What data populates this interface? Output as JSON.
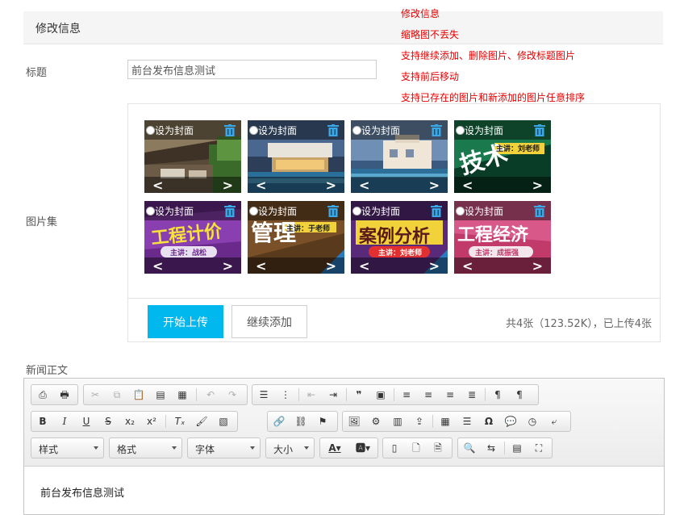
{
  "header": {
    "title": "修改信息"
  },
  "notes": [
    "修改信息",
    "缩略图不丢失",
    "支持继续添加、删除图片、修改标题图片",
    "支持前后移动",
    "支持已存在的图片和新添加的图片任意排序"
  ],
  "form": {
    "title_label": "标题",
    "title_value": "前台发布信息测试",
    "gallery_label": "图片集",
    "body_label": "新闻正文"
  },
  "gallery": {
    "cover_label": "设为封面",
    "prev_glyph": "<",
    "next_glyph": ">",
    "images": [
      {
        "overlay": ""
      },
      {
        "overlay": ""
      },
      {
        "overlay": ""
      },
      {
        "overlay": "技术",
        "sub": "主讲：刘老师"
      },
      {
        "overlay": "工程计价",
        "sub": "主讲：战松"
      },
      {
        "overlay": "管理",
        "sub": "主讲：于老师"
      },
      {
        "overlay": "案例分析",
        "sub": "主讲：刘老师"
      },
      {
        "overlay": "工程经济",
        "sub": "主讲：成振强"
      }
    ],
    "upload_button": "开始上传",
    "add_button": "继续添加",
    "stats": "共4张（123.52K），已上传4张"
  },
  "editor": {
    "combos": [
      "样式",
      "格式",
      "字体",
      "大小"
    ],
    "content": "前台发布信息测试"
  },
  "colors": {
    "accent": "#00b7ee",
    "note_red": "#e60000"
  }
}
